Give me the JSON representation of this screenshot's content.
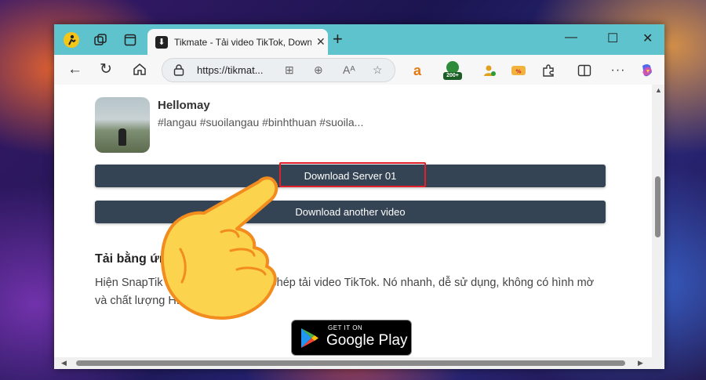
{
  "browser": {
    "tab_title": "Tikmate - Tải video TikTok, Downl",
    "address": "https://tikmat...",
    "window_controls": [
      "minimize",
      "maximize",
      "close"
    ],
    "badge_200": "200+"
  },
  "page": {
    "video_title": "Hellomay",
    "video_tags": "#langau #suoilangau #binhthuan #suoila...",
    "download_server_label": "Download Server 01",
    "download_another_label": "Download another video",
    "section_title": "Tải bằng ứng dụng (SnapTik)",
    "section_text": "Hiện SnapTik đã có ứng dụng cho phép tải video TikTok. Nó nhanh, dễ sử dụng, không có hình mờ và chất lượng HD.",
    "google_play_small": "GET IT ON",
    "google_play_big": "Google Play"
  },
  "colors": {
    "tabbar": "#5fc3cd",
    "button": "#344454",
    "highlight": "#e0202a"
  }
}
